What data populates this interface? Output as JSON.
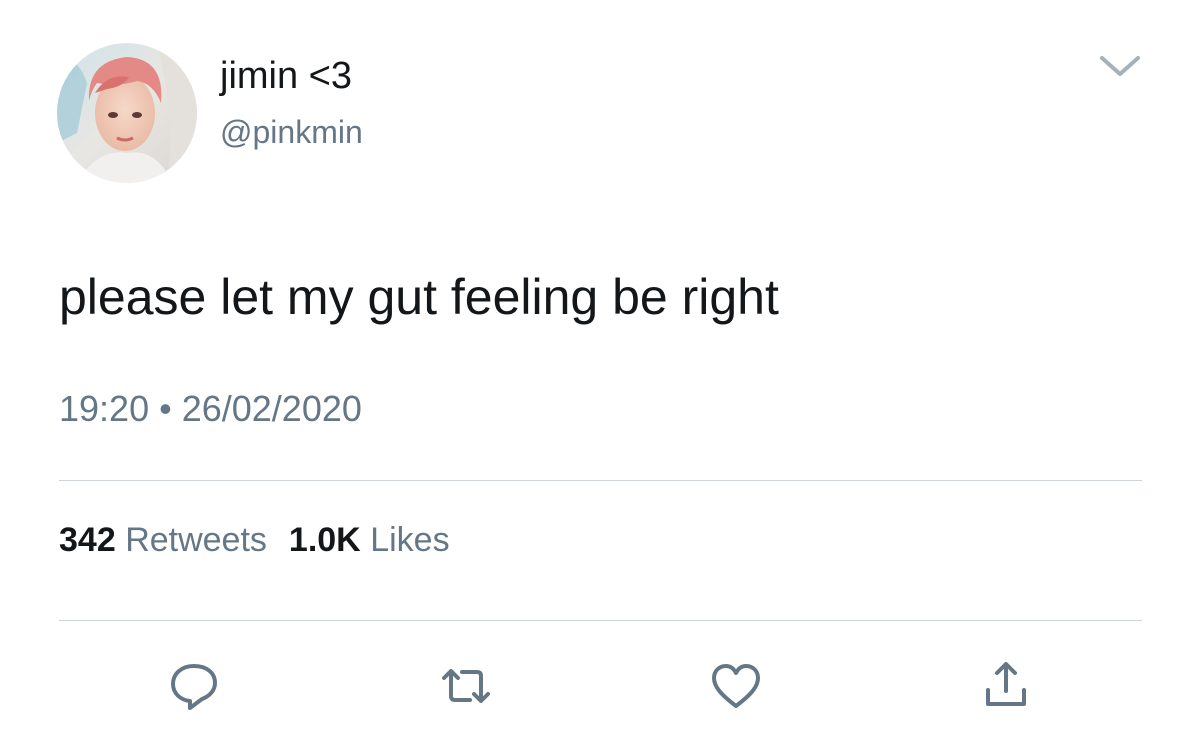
{
  "tweet": {
    "display_name": "jimin <3",
    "handle": "@pinkmin",
    "text": "please let my gut feeling be right",
    "time": "19:20",
    "separator": "•",
    "date": "26/02/2020",
    "retweets_count": "342",
    "retweets_label": "Retweets",
    "likes_count": "1.0K",
    "likes_label": "Likes"
  },
  "icons": {
    "menu": "chevron-down-icon",
    "reply": "reply-icon",
    "retweet": "retweet-icon",
    "like": "heart-icon",
    "share": "share-icon"
  },
  "colors": {
    "text_primary": "#14171a",
    "text_secondary": "#657786",
    "icon": "#657786",
    "divider": "#ccd6dd"
  }
}
